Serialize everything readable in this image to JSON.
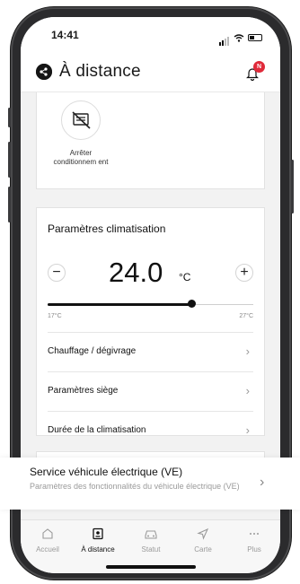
{
  "status_bar": {
    "time": "14:41"
  },
  "header": {
    "title": "À distance",
    "badge": "N"
  },
  "ac_card": {
    "label": "Arrêter conditionnem ent"
  },
  "climate": {
    "title": "Paramètres climatisation",
    "temperature": "24.0",
    "unit": "°C",
    "minus": "−",
    "plus": "+",
    "slider_min": "17°C",
    "slider_max": "27°C",
    "slider_min_value": 17,
    "slider_max_value": 27,
    "slider_value": 24.0,
    "rows": [
      {
        "label": "Chauffage / dégivrage"
      },
      {
        "label": "Paramètres siège"
      },
      {
        "label": "Durée de la climatisation"
      }
    ]
  },
  "ve_service": {
    "title": "Service véhicule électrique (VE)",
    "subtitle": "Paramètres des fonctionnalités du véhicule électrique (VE)"
  },
  "tabs": [
    {
      "label": "Accueil",
      "icon": "home-icon"
    },
    {
      "label": "À distance",
      "icon": "remote-icon",
      "active": true
    },
    {
      "label": "Statut",
      "icon": "car-icon"
    },
    {
      "label": "Carte",
      "icon": "navigation-icon"
    },
    {
      "label": "Plus",
      "icon": "more-icon"
    }
  ],
  "colors": {
    "accent": "#111111",
    "badge": "#e02a3a",
    "background": "#f2f2f2"
  }
}
